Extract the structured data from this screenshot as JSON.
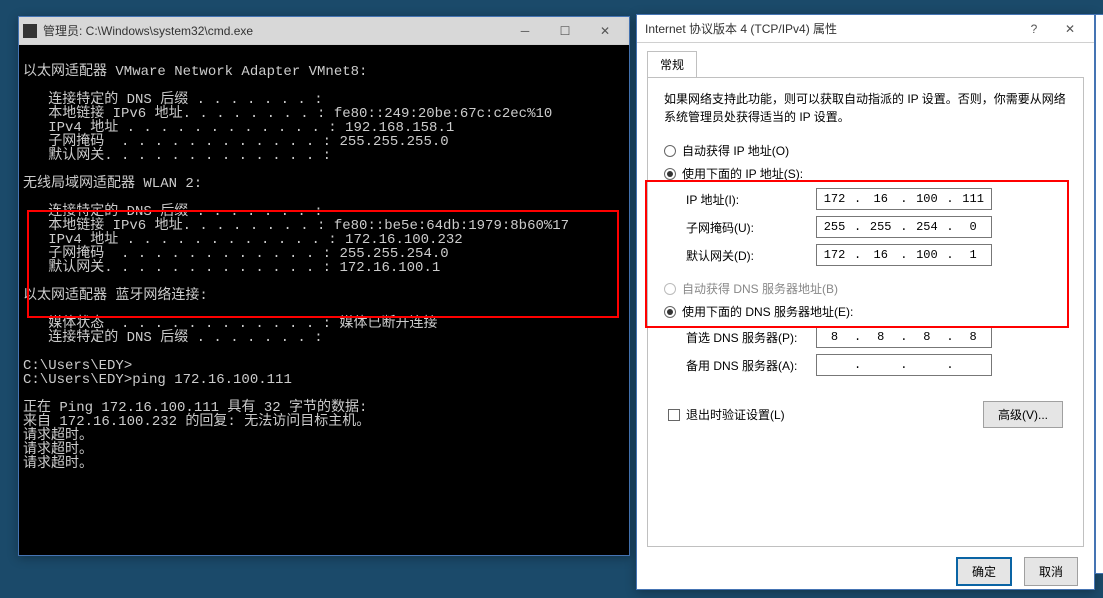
{
  "cmd": {
    "title": "管理员: C:\\Windows\\system32\\cmd.exe",
    "adapter1_header": "以太网适配器 VMware Network Adapter VMnet8:",
    "adapter1": {
      "dns": "   连接特定的 DNS 后缀 . . . . . . . :",
      "ipv6": "   本地链接 IPv6 地址. . . . . . . . : fe80::249:20be:67c:c2ec%10",
      "ipv4": "   IPv4 地址 . . . . . . . . . . . . : 192.168.158.1",
      "mask": "   子网掩码  . . . . . . . . . . . . : 255.255.255.0",
      "gw": "   默认网关. . . . . . . . . . . . . :"
    },
    "adapter2_header": "无线局域网适配器 WLAN 2:",
    "adapter2": {
      "dns": "   连接特定的 DNS 后缀 . . . . . . . :",
      "ipv6": "   本地链接 IPv6 地址. . . . . . . . : fe80::be5e:64db:1979:8b60%17",
      "ipv4": "   IPv4 地址 . . . . . . . . . . . . : 172.16.100.232",
      "mask": "   子网掩码  . . . . . . . . . . . . : 255.255.254.0",
      "gw": "   默认网关. . . . . . . . . . . . . : 172.16.100.1"
    },
    "adapter3_header": "以太网适配器 蓝牙网络连接:",
    "adapter3": {
      "media": "   媒体状态  . . . . . . . . . . . . : 媒体已断开连接",
      "dns": "   连接特定的 DNS 后缀 . . . . . . . :"
    },
    "prompt1": "C:\\Users\\EDY>",
    "prompt2": "C:\\Users\\EDY>ping 172.16.100.111",
    "ping_header": "正在 Ping 172.16.100.111 具有 32 字节的数据:",
    "ping_reply": "来自 172.16.100.232 的回复: 无法访问目标主机。",
    "ping_timeout": "请求超时。"
  },
  "props": {
    "title": "Internet 协议版本 4 (TCP/IPv4) 属性",
    "tab_general": "常规",
    "intro": "如果网络支持此功能，则可以获取自动指派的 IP 设置。否则，你需要从网络系统管理员处获得适当的 IP 设置。",
    "radio_auto_ip": "自动获得 IP 地址(O)",
    "radio_use_ip": "使用下面的 IP 地址(S):",
    "lbl_ip": "IP 地址(I):",
    "lbl_mask": "子网掩码(U):",
    "lbl_gw": "默认网关(D):",
    "ip": {
      "a": "172",
      "b": "16",
      "c": "100",
      "d": "111"
    },
    "mask": {
      "a": "255",
      "b": "255",
      "c": "254",
      "d": "0"
    },
    "gw": {
      "a": "172",
      "b": "16",
      "c": "100",
      "d": "1"
    },
    "radio_auto_dns": "自动获得 DNS 服务器地址(B)",
    "radio_use_dns": "使用下面的 DNS 服务器地址(E):",
    "lbl_dns1": "首选 DNS 服务器(P):",
    "lbl_dns2": "备用 DNS 服务器(A):",
    "dns1": {
      "a": "8",
      "b": "8",
      "c": "8",
      "d": "8"
    },
    "dns2": {
      "a": "",
      "b": "",
      "c": "",
      "d": ""
    },
    "chk_validate": "退出时验证设置(L)",
    "btn_adv": "高级(V)...",
    "btn_ok": "确定",
    "btn_cancel": "取消"
  }
}
